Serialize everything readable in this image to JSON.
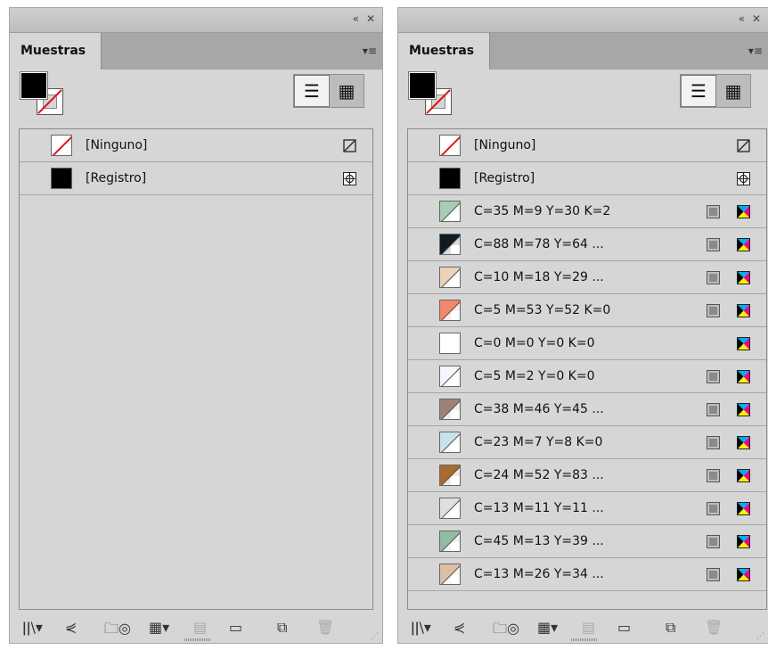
{
  "panel_controls": {
    "collapse": "«",
    "close": "✕"
  },
  "tab_label": "Muestras",
  "tab_menu_icon": "▾≡",
  "view_icons": {
    "list": "☰",
    "grid": "▦"
  },
  "footer_icons": {
    "library": "ǀǀ\\▾",
    "share": "⋞",
    "color_group": "🗀◎",
    "show_kinds": "▦▾",
    "new_swatch_group": "▤",
    "new_folder": "▭",
    "new_swatch": "⧉",
    "delete": "🗑"
  },
  "swatch_type_icons": {
    "process": "process-color-icon",
    "cmyk": "cmyk-mode-icon",
    "none": "none-edit-icon",
    "registration": "registration-icon"
  },
  "panel_a": {
    "rows": [
      {
        "name": "[Ninguno]",
        "kind": "none",
        "color": "#ffffff"
      },
      {
        "name": "[Registro]",
        "kind": "registration",
        "color": "#000000"
      }
    ]
  },
  "panel_b": {
    "rows": [
      {
        "name": "[Ninguno]",
        "kind": "none",
        "color": "#ffffff"
      },
      {
        "name": "[Registro]",
        "kind": "registration",
        "color": "#000000"
      },
      {
        "name": "C=35 M=9 Y=30 K=2",
        "kind": "process",
        "color": "#a8cdb5"
      },
      {
        "name": "C=88 M=78 Y=64 ...",
        "kind": "process",
        "color": "#0f1a22"
      },
      {
        "name": "C=10 M=18 Y=29 ...",
        "kind": "process",
        "color": "#ebd3b9"
      },
      {
        "name": "C=5 M=53 Y=52 K=0",
        "kind": "process",
        "color": "#f2876c"
      },
      {
        "name": "C=0 M=0 Y=0 K=0",
        "kind": "paper",
        "color": "#ffffff"
      },
      {
        "name": "C=5 M=2 Y=0 K=0",
        "kind": "process",
        "color": "#f3f6fb"
      },
      {
        "name": "C=38 M=46 Y=45 ...",
        "kind": "process",
        "color": "#9d8176"
      },
      {
        "name": "C=23 M=7 Y=8 K=0",
        "kind": "process",
        "color": "#c9e3ea"
      },
      {
        "name": "C=24 M=52 Y=83 ...",
        "kind": "process",
        "color": "#a86a2e"
      },
      {
        "name": "C=13 M=11 Y=11 ...",
        "kind": "process",
        "color": "#e1dfde"
      },
      {
        "name": "C=45 M=13 Y=39 ...",
        "kind": "process",
        "color": "#8fbd9f"
      },
      {
        "name": "C=13 M=26 Y=34 ...",
        "kind": "process",
        "color": "#ddbfa5"
      }
    ]
  }
}
